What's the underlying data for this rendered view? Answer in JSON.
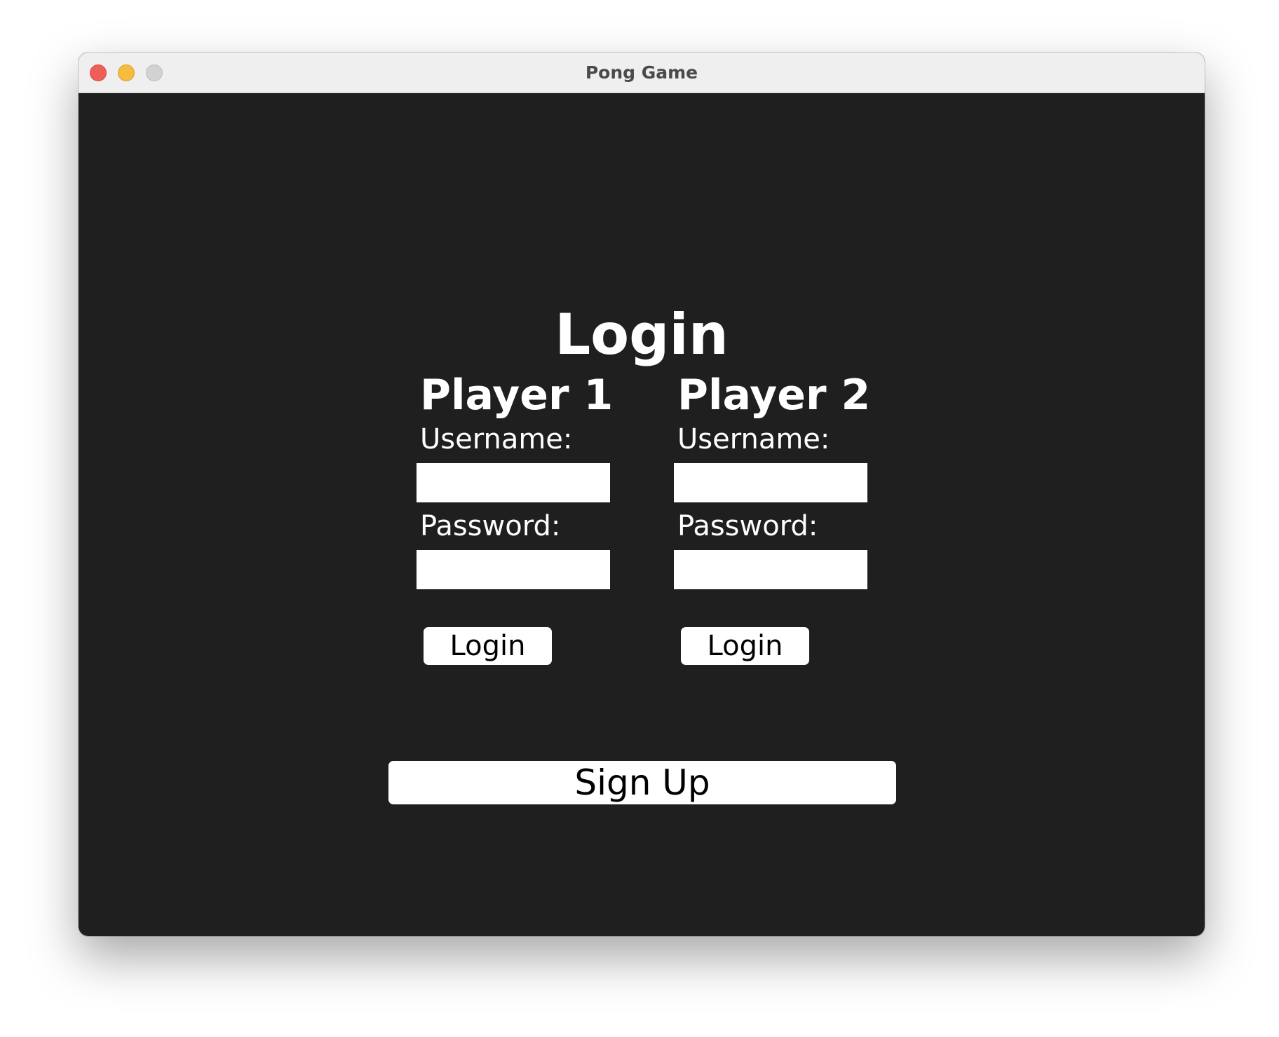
{
  "window": {
    "title": "Pong Game"
  },
  "login": {
    "heading": "Login",
    "players": [
      {
        "title": "Player 1",
        "username_label": "Username:",
        "username_value": "",
        "password_label": "Password:",
        "password_value": "",
        "login_label": "Login"
      },
      {
        "title": "Player 2",
        "username_label": "Username:",
        "username_value": "",
        "password_label": "Password:",
        "password_value": "",
        "login_label": "Login"
      }
    ],
    "signup_label": "Sign Up"
  },
  "colors": {
    "background": "#1f1f1f",
    "text": "#ffffff",
    "button": "#ffffff",
    "close": "#ee5f57",
    "minimize": "#f5bc3f",
    "maximize": "#d2d2d2"
  }
}
